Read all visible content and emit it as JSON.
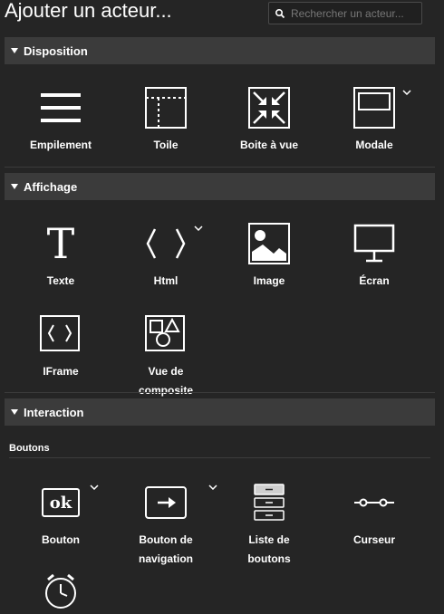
{
  "header": {
    "title": "Ajouter un acteur...",
    "search_placeholder": "Rechercher un acteur..."
  },
  "sections": {
    "disposition": {
      "label": "Disposition",
      "items": [
        "Empilement",
        "Toile",
        "Boite à vue",
        "Modale"
      ]
    },
    "affichage": {
      "label": "Affichage",
      "items": [
        "Texte",
        "Html",
        "Image",
        "Écran",
        "IFrame",
        "Vue de\ncomposite"
      ]
    },
    "interaction": {
      "label": "Interaction",
      "subheader": "Boutons",
      "items": [
        "Bouton",
        "Bouton de\nnavigation",
        "Liste de\nboutons",
        "Curseur"
      ]
    }
  },
  "icons": {
    "text_glyph": "T",
    "ok_glyph": "ok",
    "html_glyph": "〈  〉"
  },
  "colors": {
    "background": "#252525",
    "section_header": "#3b3b3b",
    "text": "#ffffff"
  }
}
